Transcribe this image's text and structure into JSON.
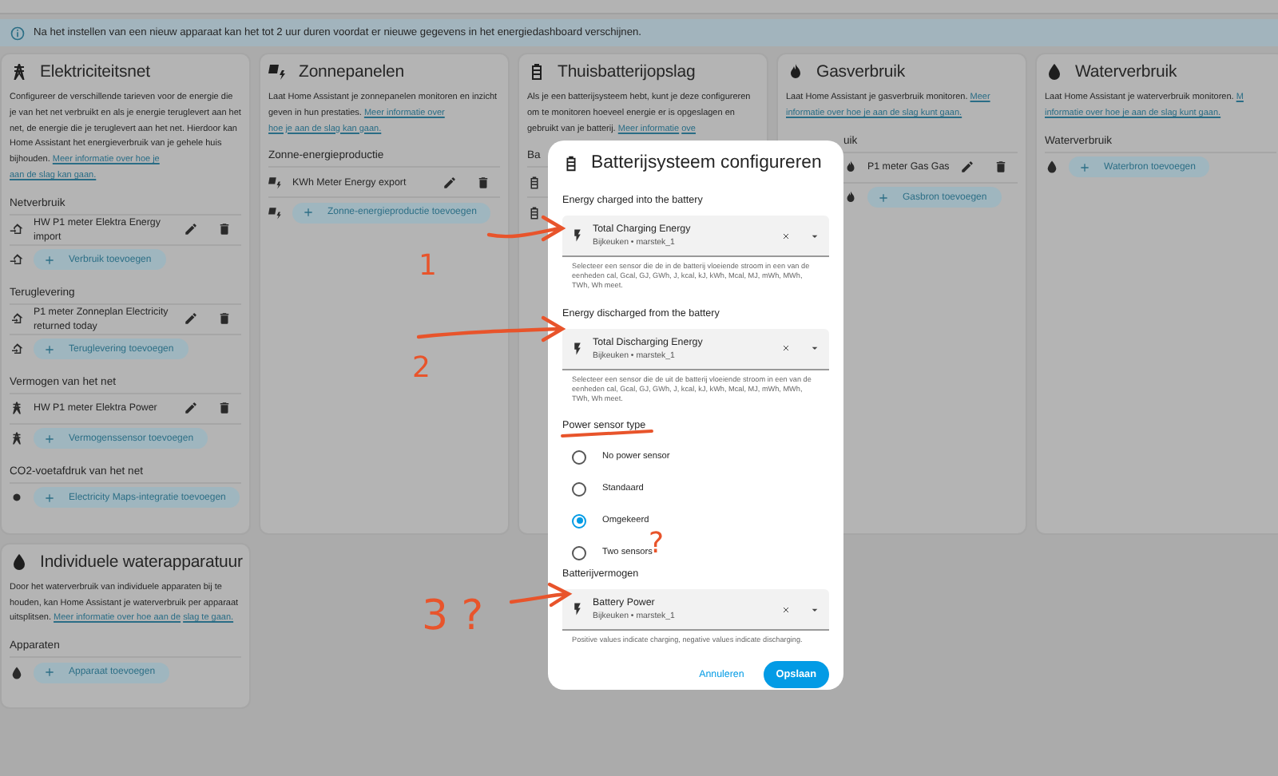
{
  "info_banner": {
    "text": "Na het instellen van een nieuw apparaat kan het tot 2 uur duren voordat er nieuwe gegevens in het energiedashboard verschijnen."
  },
  "cards": [
    {
      "kind": "grid",
      "title": "Elektriciteitsnet",
      "description": "Configureer de verschillende tarieven voor de energie die je van het net verbruikt en als je energie teruglevert aan het net, de energie die je teruglevert aan het net. Hierdoor kan Home Assistant het energieverbruik van je gehele huis bijhouden.",
      "link": [
        "Meer informatie over hoe je",
        "aan de slag kan gaan."
      ],
      "sections": [
        {
          "kind": "import",
          "label": "Netverbruik",
          "items": [
            {
              "kind": "entry",
              "label": "HW P1 meter Elektra Energy import"
            },
            {
              "kind": "add",
              "label": "Verbruik toevoegen"
            }
          ]
        },
        {
          "kind": "export",
          "label": "Teruglevering",
          "items": [
            {
              "kind": "entry",
              "label": "P1 meter Zonneplan Electricity returned today"
            },
            {
              "kind": "add",
              "label": "Teruglevering toevoegen"
            }
          ]
        },
        {
          "kind": "power",
          "label": "Vermogen van het net",
          "items": [
            {
              "kind": "entry",
              "label": "HW P1 meter Elektra Power"
            },
            {
              "kind": "add",
              "label": "Vermogenssensor toevoegen"
            }
          ]
        },
        {
          "kind": "co2",
          "label": "CO2-voetafdruk van het net",
          "items": [
            {
              "kind": "add",
              "label": "Electricity Maps-integratie toevoegen"
            }
          ]
        }
      ]
    },
    {
      "kind": "solar",
      "title": "Zonnepanelen",
      "description": "Laat Home Assistant je zonnepanelen monitoren en inzicht geven in hun prestaties.",
      "link": [
        "Meer informatie over",
        "hoe je aan de slag kan gaan."
      ],
      "sections": [
        {
          "kind": "solar",
          "label": "Zonne-energieproductie",
          "items": [
            {
              "kind": "entry",
              "label": "KWh Meter Energy export"
            },
            {
              "kind": "add",
              "label": "Zonne-energieproductie toevoegen"
            }
          ]
        }
      ]
    },
    {
      "kind": "battery",
      "title": "Thuisbatterijopslag",
      "description": "Als je een batterijsysteem hebt, kunt je deze configureren om te monitoren hoeveel energie er is opgeslagen en gebruikt van je batterij.",
      "link": [
        "Meer informatie",
        "ove"
      ],
      "sections": [
        {
          "kind": "battery",
          "label": "Ba",
          "items": [
            {
              "kind": "covered"
            },
            {
              "kind": "covered"
            }
          ]
        }
      ]
    },
    {
      "kind": "gas",
      "title": "Gasverbruik",
      "description": "Laat Home Assistant je gasverbruik monitoren.",
      "link": [
        "Meer",
        "informatie over hoe je aan de slag kunt gaan."
      ],
      "partly_covered": true,
      "sections": [
        {
          "kind": "gas",
          "label": "uik",
          "items": [
            {
              "kind": "entry",
              "label": "P1 meter Gas Gas"
            },
            {
              "kind": "add",
              "label": "Gasbron toevoegen"
            }
          ]
        }
      ]
    },
    {
      "kind": "water",
      "title": "Waterverbruik",
      "description": "Laat Home Assistant je waterverbruik monitoren.",
      "link": [
        "M",
        "informatie over hoe je aan de slag kunt gaan."
      ],
      "sections": [
        {
          "kind": "water",
          "label": "Waterverbruik",
          "items": [
            {
              "kind": "add",
              "label": "Waterbron toevoegen"
            }
          ]
        }
      ]
    },
    {
      "kind": "water",
      "title": "Individuele waterapparatuur",
      "description": "Door het waterverbruik van individuele apparaten bij te houden, kan Home Assistant je waterverbruik per apparaat uitsplitsen.",
      "link": [
        "Meer informatie over hoe aan de",
        "slag te gaan."
      ],
      "sections": [
        {
          "kind": "water",
          "label": "Apparaten",
          "items": [
            {
              "kind": "add",
              "label": "Apparaat toevoegen"
            }
          ]
        }
      ]
    }
  ],
  "dialog": {
    "title": "Batterijsysteem configureren",
    "fields": [
      {
        "kind": "picker",
        "label": "Energy charged into the battery",
        "value": "Total Charging Energy",
        "sub": "Bijkeuken • marstek_1",
        "helper": "Selecteer een sensor die de in de batterij vloeiende stroom in een van de eenheden cal, Gcal, GJ, GWh, J, kcal, kJ, kWh, Mcal, MJ, mWh, MWh, TWh, Wh meet."
      },
      {
        "kind": "picker",
        "label": "Energy discharged from the battery",
        "value": "Total Discharging Energy",
        "sub": "Bijkeuken • marstek_1",
        "helper": "Selecteer een sensor die de uit de batterij vloeiende stroom in een van de eenheden cal, Gcal, GJ, GWh, J, kcal, kJ, kWh, Mcal, MJ, mWh, MWh, TWh, Wh meet."
      },
      {
        "kind": "radios",
        "label": "Power sensor type",
        "options": [
          {
            "label": "No power sensor",
            "selected": false
          },
          {
            "label": "Standaard",
            "selected": false
          },
          {
            "label": "Omgekeerd",
            "selected": true
          },
          {
            "label": "Two sensors",
            "selected": false
          }
        ]
      },
      {
        "kind": "picker",
        "label": "Batterijvermogen",
        "value": "Battery Power",
        "sub": "Bijkeuken • marstek_1",
        "helper": "Positive values indicate charging, negative values indicate discharging."
      }
    ],
    "cancel": "Annuleren",
    "save": "Opslaan"
  },
  "annotations": [
    {
      "kind": "arrow"
    },
    {
      "kind": "label",
      "text": "1"
    },
    {
      "kind": "arrow"
    },
    {
      "kind": "label",
      "text": "2"
    },
    {
      "kind": "underline"
    },
    {
      "kind": "label",
      "text": "?"
    },
    {
      "kind": "label",
      "text": "3 ?"
    },
    {
      "kind": "arrow"
    }
  ]
}
